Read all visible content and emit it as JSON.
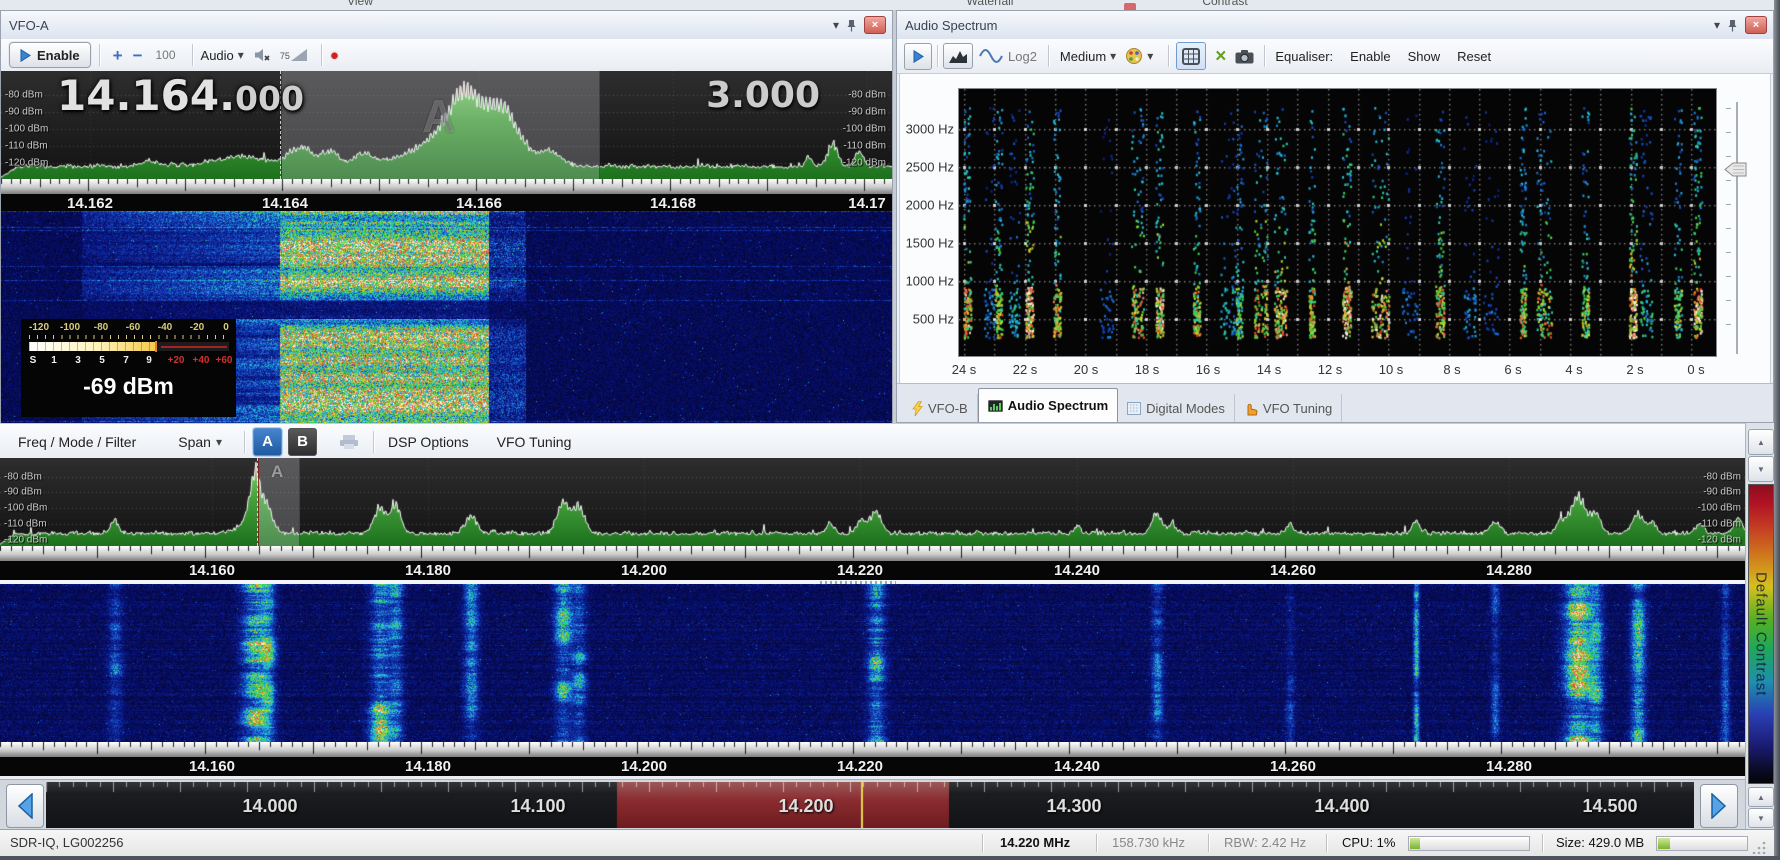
{
  "window": {
    "ribbon_labels": [
      "View",
      "Waterfall",
      "Contrast"
    ],
    "status": {
      "device": "SDR-IQ, LG002256",
      "frequency": "14.220 MHz",
      "bandwidth": "158.730 kHz",
      "rbw": "RBW: 2.42 Hz",
      "cpu": "CPU: 1%",
      "size": "Size: 429.0 MB"
    }
  },
  "icons": {
    "dropdown": "▾",
    "plus": "+",
    "minus": "−",
    "record_dot": "●",
    "close": "×",
    "green_x": "×",
    "up_arrow": "▲",
    "down_arrow": "▼"
  },
  "vfo_a": {
    "title": "VFO-A",
    "toolbar": {
      "enable": "Enable",
      "gain_value": "100",
      "audio": "Audio",
      "volume_value": "75"
    },
    "display": {
      "frequency_main": "14.164.",
      "frequency_decimals": "000",
      "filter_width": "3.000",
      "marker": "A"
    },
    "db_labels": [
      "-80 dBm",
      "-90 dBm",
      "-100 dBm",
      "-110 dBm",
      "-120 dBm"
    ],
    "freq_ticks": [
      "14.162",
      "14.164",
      "14.166",
      "14.168",
      "14.17"
    ],
    "meter": {
      "db_scale": [
        "-120",
        "-100",
        "-80",
        "-60",
        "-40",
        "-20",
        "0"
      ],
      "s_scale": [
        "S",
        "1",
        "3",
        "5",
        "7",
        "9"
      ],
      "over_scale": [
        "+20",
        "+40",
        "+60"
      ],
      "reading": "-69 dBm"
    }
  },
  "audio_spectrum": {
    "title": "Audio Spectrum",
    "toolbar": {
      "log": "Log2",
      "speed": "Medium",
      "equaliser_label": "Equaliser:",
      "enable": "Enable",
      "show": "Show",
      "reset": "Reset"
    },
    "y_ticks": [
      "3000 Hz",
      "2500 Hz",
      "2000 Hz",
      "1500 Hz",
      "1000 Hz",
      "500 Hz"
    ],
    "x_ticks": [
      "24 s",
      "22 s",
      "20 s",
      "18 s",
      "16 s",
      "14 s",
      "12 s",
      "10 s",
      "8 s",
      "6 s",
      "4 s",
      "2 s",
      "0 s"
    ]
  },
  "tabs": [
    {
      "label": "VFO-B"
    },
    {
      "label": "Audio Spectrum"
    },
    {
      "label": "Digital Modes"
    },
    {
      "label": "VFO Tuning"
    }
  ],
  "main_display": {
    "toolbar": {
      "freq_mode_filter": "Freq / Mode / Filter",
      "span": "Span",
      "vfo_a": "A",
      "vfo_b": "B",
      "dsp_options": "DSP Options",
      "vfo_tuning": "VFO Tuning"
    },
    "db_labels": [
      "-80 dBm",
      "-90 dBm",
      "-100 dBm",
      "-110 dBm",
      "-120 dBm"
    ],
    "freq_ticks": [
      "14.160",
      "14.180",
      "14.200",
      "14.220",
      "14.240",
      "14.260",
      "14.280"
    ],
    "marker": "A"
  },
  "navigator": {
    "freq_ticks": [
      "14.000",
      "14.100",
      "14.200",
      "14.300",
      "14.400",
      "14.500"
    ]
  },
  "contrast": {
    "label": "Default Contrast"
  },
  "colors": {
    "accent_blue": "#2f6fbe",
    "record_red": "#cc2222",
    "spectrum_green": "#3c9e35",
    "selection_red_edge": "#7a2020",
    "nav_highlight_red": "#7e2228",
    "current_freq_yellow": "#e8d44d"
  }
}
